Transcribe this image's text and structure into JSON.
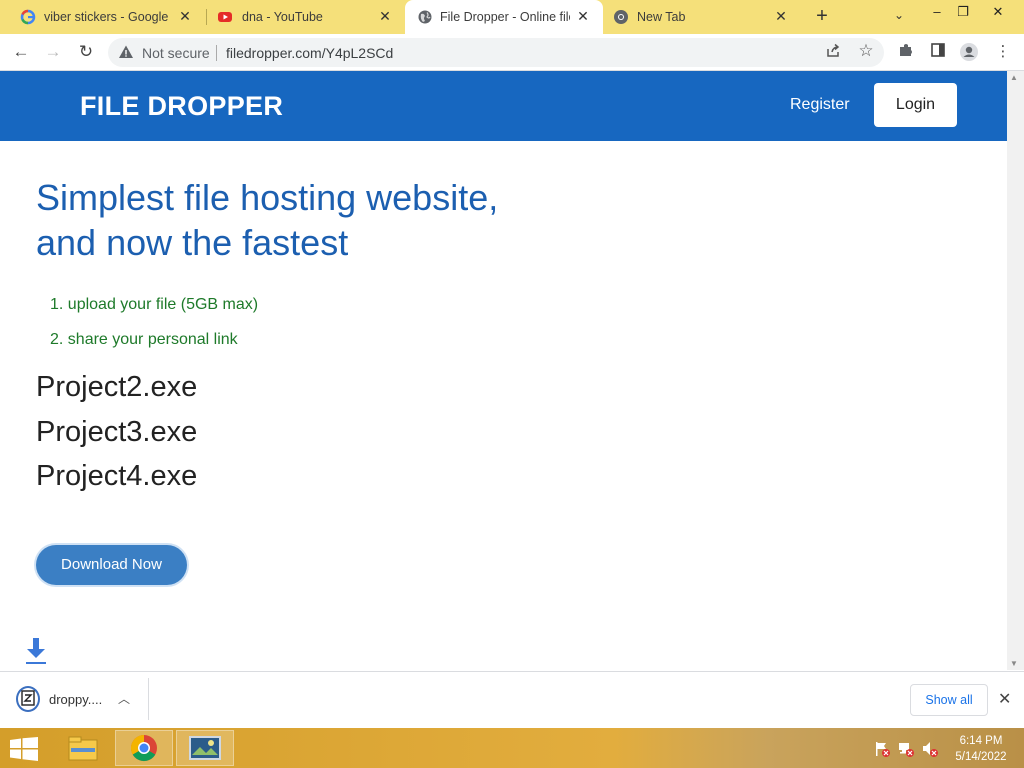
{
  "browser": {
    "tabs": [
      {
        "title": "viber stickers - Google Se",
        "icon": "google-icon",
        "active": false
      },
      {
        "title": "dna - YouTube",
        "icon": "youtube-icon",
        "active": false
      },
      {
        "title": "File Dropper - Online file",
        "icon": "globe-icon",
        "active": true
      },
      {
        "title": "New Tab",
        "icon": "chrome-icon",
        "active": false
      }
    ],
    "new_tab_label": "+",
    "address": {
      "security_label": "Not secure",
      "url": "filedropper.com/Y4pL2SCd"
    }
  },
  "site": {
    "brand": "FILE DROPPER",
    "register_label": "Register",
    "login_label": "Login",
    "hero_line1": "Simplest file hosting website,",
    "hero_line2": "and now the fastest",
    "steps": [
      "1. upload your file (5GB max)",
      "2. share your personal link"
    ],
    "files": [
      "Project2.exe",
      "Project3.exe",
      "Project4.exe"
    ],
    "download_button": "Download Now"
  },
  "download_bar": {
    "file_name": "droppy....",
    "show_all_label": "Show all"
  },
  "taskbar": {
    "time": "6:14 PM",
    "date": "5/14/2022"
  },
  "colors": {
    "header_blue": "#1767c0",
    "hero_blue": "#1c5fb0",
    "step_green": "#1e7a2a",
    "button_blue": "#3b7fc4",
    "tabstrip_yellow": "#f5e07a"
  }
}
